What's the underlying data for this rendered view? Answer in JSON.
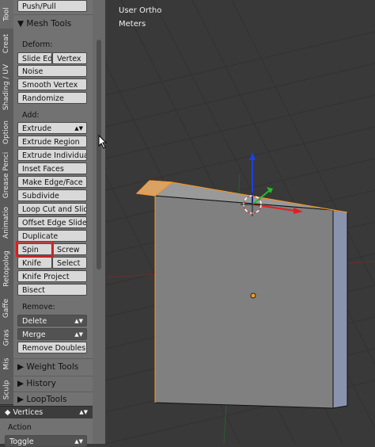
{
  "tabs": [
    "Tool",
    "Creat",
    "Shading / UV",
    "Option",
    "Grease Penci",
    "Animatio",
    "Retopolog",
    "Gaffe",
    "Gras",
    "Mis",
    "Sculp"
  ],
  "shelf": {
    "top_button": "Push/Pull",
    "panel_title": "Mesh Tools",
    "deform_label": "Deform:",
    "deform": {
      "slide_edge": "Slide Ed",
      "vertex": "Vertex",
      "noise": "Noise",
      "smooth_vertex": "Smooth Vertex",
      "randomize": "Randomize"
    },
    "add_label": "Add:",
    "extrude_menu": "Extrude",
    "add": {
      "extrude_region": "Extrude Region",
      "extrude_individual": "Extrude Individual",
      "inset_faces": "Inset Faces",
      "make_edge_face": "Make Edge/Face",
      "subdivide": "Subdivide",
      "loop_cut": "Loop Cut and Slide",
      "offset_edge": "Offset Edge Slide",
      "duplicate": "Duplicate",
      "spin": "Spin",
      "screw": "Screw",
      "knife": "Knife",
      "select": "Select",
      "knife_project": "Knife Project",
      "bisect": "Bisect"
    },
    "remove_label": "Remove:",
    "remove": {
      "delete": "Delete",
      "merge": "Merge",
      "remove_doubles": "Remove Doubles"
    },
    "collapsed_panels": [
      "Weight Tools",
      "History",
      "LoopTools"
    ],
    "mode_select": "Vertices",
    "action_label": "Action",
    "action_value": "Toggle"
  },
  "viewport": {
    "view_name": "User Ortho",
    "units": "Meters"
  },
  "colors": {
    "highlight": "#e21d1d",
    "selection": "#f59a2d",
    "x_axis": "#e02020",
    "y_axis": "#22c022",
    "z_axis": "#1f3fe0"
  }
}
